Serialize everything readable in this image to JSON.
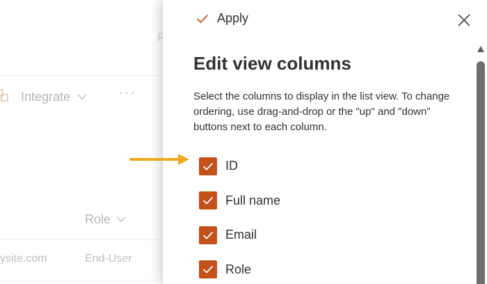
{
  "background_page": {
    "partial_header_letter": "P",
    "toolbar": {
      "integrate_label": "Integrate",
      "more_label": "···"
    },
    "table": {
      "columns": [
        {
          "label": "Role"
        }
      ],
      "rows": [
        {
          "email": "ysite.com",
          "role": "End-User"
        }
      ]
    }
  },
  "panel": {
    "apply_label": "Apply",
    "close_icon": "close-icon",
    "title": "Edit view columns",
    "description": "Select the columns to display in the list view. To change ordering, use drag-and-drop or the \"up\" and \"down\" buttons next to each column.",
    "columns": [
      {
        "label": "ID",
        "checked": true
      },
      {
        "label": "Full name",
        "checked": true
      },
      {
        "label": "Email",
        "checked": true
      },
      {
        "label": "Role",
        "checked": true
      }
    ]
  },
  "colors": {
    "accent": "#c4501a",
    "annotation_arrow": "#f0a81c",
    "text_primary": "#323130"
  }
}
